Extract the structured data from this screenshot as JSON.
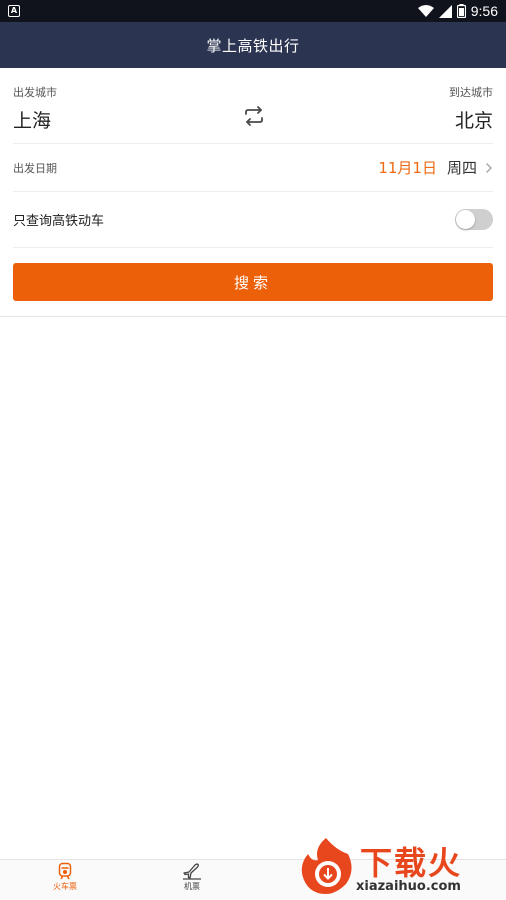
{
  "status_bar": {
    "notification_icon": "A",
    "time": "9:56"
  },
  "header": {
    "title": "掌上高铁出行"
  },
  "form": {
    "departure_label": "出发城市",
    "departure_city": "上海",
    "arrival_label": "到达城市",
    "arrival_city": "北京",
    "date_label": "出发日期",
    "date_value": "11月1日",
    "weekday": "周四",
    "filter_label": "只查询高铁动车",
    "filter_enabled": false,
    "search_label": "搜索"
  },
  "tabs": [
    {
      "label": "火车票",
      "icon": "train-icon",
      "active": true
    },
    {
      "label": "机票",
      "icon": "plane-icon",
      "active": false
    }
  ],
  "watermark": {
    "brand": "下载火",
    "url": "xiazaihuo.com"
  },
  "colors": {
    "header_bg": "#2b3450",
    "accent": "#ec6009",
    "date_color": "#ee6a12"
  }
}
